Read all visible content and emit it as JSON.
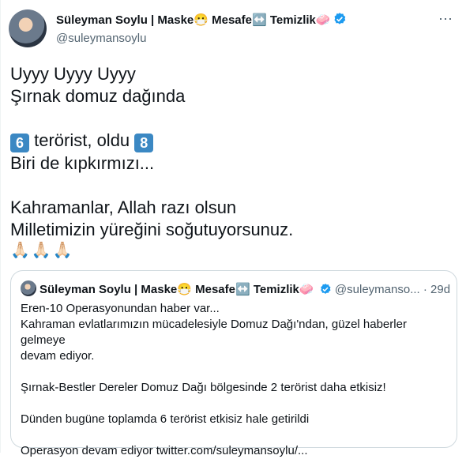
{
  "tweet": {
    "display_name": "Süleyman Soylu | Maske😷 Mesafe↔️ Temizlik🧼",
    "handle": "@suleymansoylu",
    "more_icon": "⋯",
    "line1": "Uyyy Uyyy Uyyy",
    "line2": "Şırnak domuz dağında",
    "badge1": "6",
    "line3_middle": " terörist, oldu ",
    "badge2": "8",
    "line4": "Biri de kıpkırmızı...",
    "line5": "Kahramanlar, Allah razı olsun",
    "line6": "Milletimizin yüreğini soğutuyorsunuz.",
    "emojis": "🙏🏻🙏🏻🙏🏻"
  },
  "quote": {
    "display_name": "Süleyman Soylu | Maske😷 Mesafe↔️ Temizlik🧼",
    "handle": "@suleymanso...",
    "dot": "·",
    "time": "29d",
    "text": "Eren-10 Operasyonundan haber var...\nKahraman evlatlarımızın mücadelesiyle Domuz Dağı'ndan, güzel haberler gelmeye\ndevam ediyor.\n\nŞırnak-Bestler Dereler Domuz Dağı bölgesinde 2 terörist daha etkisiz!\n\nDünden bugüne toplamda 6 terörist etkisiz hale getirildi\n\nOperasyon devam ediyor twitter.com/suleymansoylu/..."
  },
  "colors": {
    "verified": "#1d9bf0",
    "keycap": "#3b88c3",
    "muted": "#536471"
  }
}
